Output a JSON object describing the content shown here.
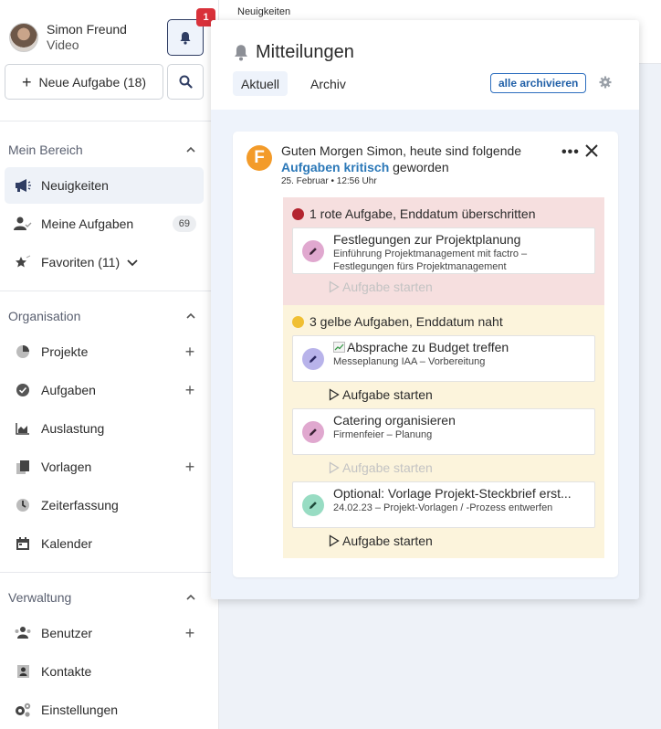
{
  "user": {
    "name": "Simon Freund",
    "role": "Video"
  },
  "notifications_badge": "1",
  "new_task_label": "Neue Aufgabe (18)",
  "sections": {
    "mein_bereich": "Mein Bereich",
    "organisation": "Organisation",
    "verwaltung": "Verwaltung"
  },
  "nav": {
    "neuigkeiten": "Neuigkeiten",
    "meine_aufgaben": "Meine Aufgaben",
    "meine_aufgaben_count": "69",
    "favoriten": "Favoriten (11)",
    "projekte": "Projekte",
    "aufgaben": "Aufgaben",
    "auslastung": "Auslastung",
    "vorlagen": "Vorlagen",
    "zeiterfassung": "Zeiterfassung",
    "kalender": "Kalender",
    "benutzer": "Benutzer",
    "kontakte": "Kontakte",
    "einstellungen": "Einstellungen"
  },
  "breadcrumb": "Neuigkeiten",
  "panel": {
    "title": "Mitteilungen",
    "tabs": [
      "Aktuell",
      "Archiv"
    ],
    "archive_all": "alle archivieren"
  },
  "notification": {
    "avatar_letter": "F",
    "text_pre": "Guten Morgen Simon, heute sind folgende ",
    "text_link": "Aufgaben kritisch",
    "text_post": " geworden",
    "time": "25. Februar • 12:56 Uhr",
    "more": "•••"
  },
  "groups": {
    "red": {
      "title": "1 rote Aufgabe, Enddatum überschritten",
      "color": "#b3242f",
      "tasks": [
        {
          "title": "Festlegungen zur Projektplanung",
          "sub": "Einführung Projektmanagement mit factro – Festlegungen fürs Projektmanagement",
          "icon_color": "#e0a8cf",
          "start": "Aufgabe starten"
        }
      ]
    },
    "yellow": {
      "title": "3 gelbe Aufgaben, Enddatum naht",
      "color": "#f0bf33",
      "tasks": [
        {
          "title": "Absprache zu Budget treffen",
          "sub": "Messeplanung IAA – Vorbereitung",
          "icon_color": "#b8b3ea",
          "start": "Aufgabe starten"
        },
        {
          "title": "Catering organisieren",
          "sub": "Firmenfeier – Planung",
          "icon_color": "#e0a8cf",
          "start": "Aufgabe starten"
        },
        {
          "title": "Optional: Vorlage Projekt-Steckbrief erst...",
          "sub": "24.02.23 – Projekt-Vorlagen / -Prozess entwerfen",
          "icon_color": "#98dcc3",
          "start": "Aufgabe starten"
        }
      ]
    }
  }
}
